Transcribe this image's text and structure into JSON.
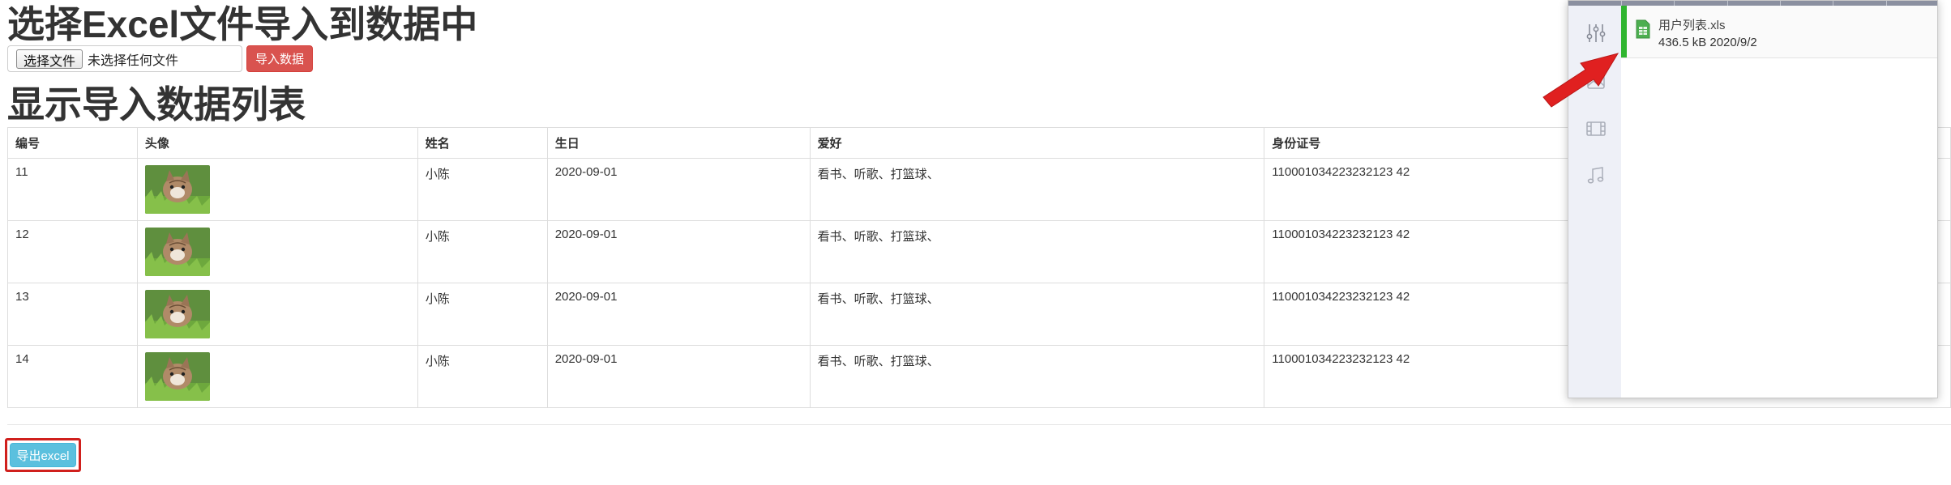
{
  "import_section": {
    "title": "选择Excel文件导入到数据中",
    "choose_file_label": "选择文件",
    "file_status": "未选择任何文件",
    "import_button_label": "导入数据"
  },
  "list_section": {
    "title": "显示导入数据列表",
    "columns": [
      "编号",
      "头像",
      "姓名",
      "生日",
      "爱好",
      "身份证号"
    ],
    "rows": [
      {
        "id": "11",
        "name": "小陈",
        "birthday": "2020-09-01",
        "hobby": "看书、听歌、打篮球、",
        "id_card": "110001034223232123 42"
      },
      {
        "id": "12",
        "name": "小陈",
        "birthday": "2020-09-01",
        "hobby": "看书、听歌、打篮球、",
        "id_card": "110001034223232123 42"
      },
      {
        "id": "13",
        "name": "小陈",
        "birthday": "2020-09-01",
        "hobby": "看书、听歌、打篮球、",
        "id_card": "110001034223232123 42"
      },
      {
        "id": "14",
        "name": "小陈",
        "birthday": "2020-09-01",
        "hobby": "看书、听歌、打篮球、",
        "id_card": "110001034223232123 42"
      }
    ]
  },
  "export_button_label": "导出excel",
  "downloads_panel": {
    "file_name": "用户列表.xls",
    "file_meta": "436.5 kB 2020/9/2"
  },
  "colors": {
    "import_button": "#d9534f",
    "export_button": "#5bc0de",
    "highlight_border": "#d0201d",
    "download_accent": "#2fb52f",
    "arrow": "#e02020"
  }
}
